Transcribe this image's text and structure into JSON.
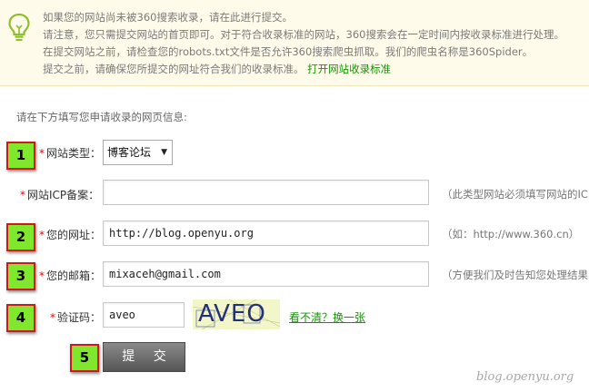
{
  "notice": {
    "line1": "如果您的网站尚未被360搜索收录，请在此进行提交。",
    "line2": "请注意，您只需提交网站的首页即可。对于符合收录标准的网站，360搜索会在一定时间内按收录标准进行处理。",
    "line3": "在提交网站之前，请检查您的robots.txt文件是否允许360搜索爬虫抓取。我们的爬虫名称是360Spider。",
    "line4_text": "提交之前，请确保您所提交的网址符合我们的收录标准。",
    "line4_link": "打开网站收录标准"
  },
  "form": {
    "intro": "请在下方填写您申请收录的网页信息:",
    "required_mark": "*",
    "site_type": {
      "label": "网站类型：",
      "selected": "博客论坛"
    },
    "icp": {
      "label": "网站ICP备案：",
      "value": "",
      "hint": "（此类型网站必须填写网站的IC"
    },
    "url": {
      "label": "您的网址：",
      "value": "http://blog.openyu.org",
      "hint": "（如：http://www.360.cn）"
    },
    "email": {
      "label": "您的邮箱：",
      "value": "mixaceh@gmail.com",
      "hint": "（方便我们及时告知您处理结果"
    },
    "captcha": {
      "label": "验证码：",
      "value": "aveo",
      "image_text": "AVEO",
      "refresh": "看不清？换一张"
    },
    "submit_label": "提 交"
  },
  "steps": [
    "1",
    "2",
    "3",
    "4",
    "5"
  ],
  "watermark": "blog.openyu.org",
  "colors": {
    "notice_bg": "#fffbea",
    "link_green": "#19930a",
    "required_red": "#e60000",
    "step_green": "#7fe82c",
    "step_border": "#d01818"
  }
}
